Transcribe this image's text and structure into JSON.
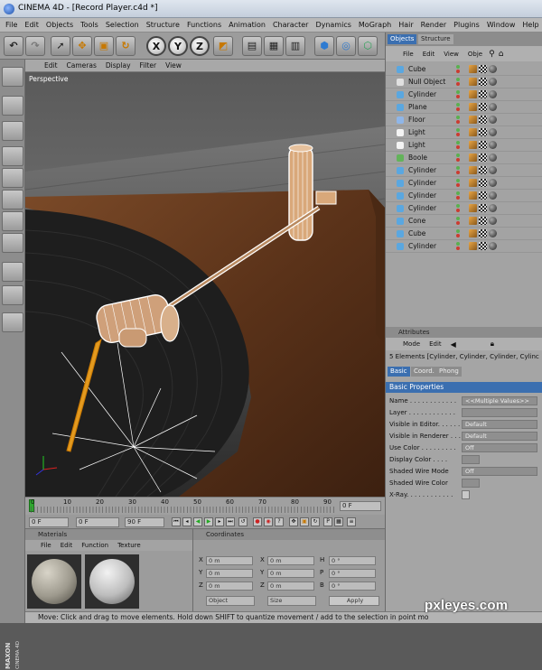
{
  "window": {
    "title": "CINEMA 4D - [Record Player.c4d *]"
  },
  "menu": [
    "File",
    "Edit",
    "Objects",
    "Tools",
    "Selection",
    "Structure",
    "Functions",
    "Animation",
    "Character",
    "Dynamics",
    "MoGraph",
    "Hair",
    "Render",
    "Plugins",
    "Window",
    "Help"
  ],
  "toolbar": {
    "axis_x": "X",
    "axis_y": "Y",
    "axis_z": "Z"
  },
  "viewport": {
    "menu": [
      "Edit",
      "Cameras",
      "Display",
      "Filter",
      "View"
    ],
    "label": "Perspective"
  },
  "timeline": {
    "ticks": [
      "0",
      "10",
      "20",
      "30",
      "40",
      "50",
      "60",
      "70",
      "80",
      "90"
    ],
    "end_field": "0 F"
  },
  "transport": {
    "current": "0 F",
    "start": "0 F",
    "end": "90 F"
  },
  "materials": {
    "title": "Materials",
    "menu": [
      "File",
      "Edit",
      "Function",
      "Texture"
    ]
  },
  "coordinates": {
    "title": "Coordinates",
    "rows": [
      {
        "a": "X",
        "av": "0 m",
        "b": "X",
        "bv": "0 m",
        "c": "H",
        "cv": "0 °"
      },
      {
        "a": "Y",
        "av": "0 m",
        "b": "Y",
        "bv": "0 m",
        "c": "P",
        "cv": "0 °"
      },
      {
        "a": "Z",
        "av": "0 m",
        "b": "Z",
        "bv": "0 m",
        "c": "B",
        "cv": "0 °"
      }
    ],
    "mode1": "Object",
    "mode2": "Size",
    "apply": "Apply"
  },
  "objects": {
    "tabs": [
      "Objects",
      "Structure"
    ],
    "menu": [
      "File",
      "Edit",
      "View",
      "Obje"
    ],
    "items": [
      {
        "name": "Cube",
        "color": "#5aa7e0"
      },
      {
        "name": "Null Object",
        "color": "#e0e0e0"
      },
      {
        "name": "Cylinder",
        "color": "#5aa7e0"
      },
      {
        "name": "Plane",
        "color": "#5aa7e0"
      },
      {
        "name": "Floor",
        "color": "#8fb6e8"
      },
      {
        "name": "Light",
        "color": "#f4f4f4"
      },
      {
        "name": "Light",
        "color": "#f4f4f4"
      },
      {
        "name": "Boole",
        "color": "#63b35a"
      },
      {
        "name": "Cylinder",
        "color": "#5aa7e0"
      },
      {
        "name": "Cylinder",
        "color": "#5aa7e0"
      },
      {
        "name": "Cylinder",
        "color": "#5aa7e0"
      },
      {
        "name": "Cylinder",
        "color": "#5aa7e0"
      },
      {
        "name": "Cone",
        "color": "#5aa7e0"
      },
      {
        "name": "Cube",
        "color": "#5aa7e0"
      },
      {
        "name": "Cylinder",
        "color": "#5aa7e0"
      }
    ]
  },
  "attributes": {
    "title": "Attributes",
    "menu": [
      "Mode",
      "Edit"
    ],
    "selection": "5 Elements [Cylinder, Cylinder, Cylinder, Cylinc",
    "tabs": [
      "Basic",
      "Coord.",
      "Phong"
    ],
    "section": "Basic Properties",
    "rows": [
      {
        "label": "Name . . . . . . . . . . . .",
        "value": "<<Multiple Values>>"
      },
      {
        "label": "Layer . . . . . . . . . . . .",
        "value": ""
      },
      {
        "label": "Visible in Editor. . . . . .",
        "value": "Default"
      },
      {
        "label": "Visible in Renderer . . .",
        "value": "Default"
      },
      {
        "label": "Use Color . . . . . . . . .",
        "value": "Off"
      },
      {
        "label": "Display Color . . . .",
        "value": ""
      },
      {
        "label": "Shaded Wire Mode",
        "value": "Off"
      },
      {
        "label": "Shaded Wire Color",
        "value": ""
      },
      {
        "label": "X-Ray. . . . . . . . . . . .",
        "value": ""
      }
    ]
  },
  "status": "Move: Click and drag to move elements. Hold down SHIFT to quantize movement / add to the selection in point mo",
  "branding": {
    "vendor": "MAXON",
    "product": "CINEMA 4D",
    "watermark": "pxleyes.com"
  },
  "colors": {
    "accent_blue": "#3b6fb0",
    "wood": "#6b3f22",
    "platter": "#1e1e1e"
  }
}
